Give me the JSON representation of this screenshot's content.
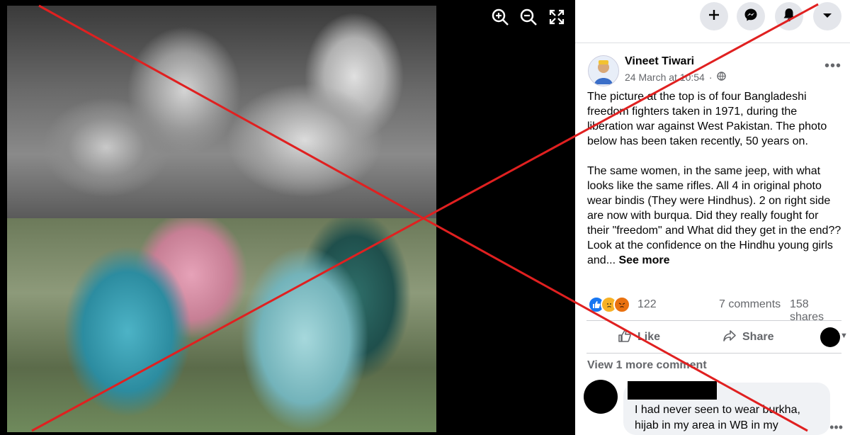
{
  "post": {
    "author": "Vineet Tiwari",
    "timestamp": "24 March at 10:54",
    "visibility_icon": "globe-icon",
    "text_para1": "The picture at the top is of four Bangladeshi freedom fighters taken in 1971, during the liberation war against West Pakistan. The photo below has been taken recently, 50 years on.",
    "text_para2": "The same women, in the same jeep, with what looks like the same rifles. All 4 in original photo wear bindis (They were Hindhus). 2 on right side are now with burqua. Did they really fought for their \"freedom\" and What did they get in the end?? Look at the confidence on the Hindhu young girls and...",
    "see_more": "See more",
    "reaction_count": "122",
    "comments_count": "7 comments",
    "shares_count": "158 shares",
    "like_label": "Like",
    "share_label": "Share",
    "view_more_comments": "View 1 more comment",
    "comment_text": "I had never seen to wear burkha, hijab in my area in WB in my"
  },
  "topbar": {
    "icons": [
      "plus-icon",
      "messenger-icon",
      "bell-icon",
      "caret-down-icon"
    ]
  },
  "viewer": {
    "icons": [
      "zoom-in-icon",
      "zoom-out-icon",
      "fullscreen-icon"
    ]
  },
  "colors": {
    "facebook_blue": "#1877f2",
    "cross_red": "#e02020"
  }
}
